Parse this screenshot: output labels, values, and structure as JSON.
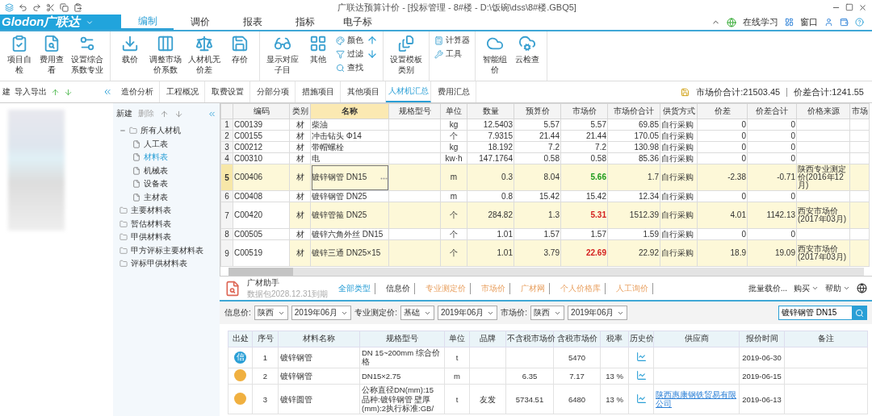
{
  "window": {
    "title": "广联达预算计价 - [投标管理 - 8#楼 - D:\\饭碗\\dss\\8#楼.GBQ5]"
  },
  "menu": {
    "logo": "Glodon广联达",
    "tabs": [
      {
        "label": "编制",
        "selected": true
      },
      {
        "label": "调价",
        "selected": false
      },
      {
        "label": "报表",
        "selected": false
      },
      {
        "label": "指标",
        "selected": false
      },
      {
        "label": "电子标",
        "selected": false
      }
    ],
    "right": [
      "在线学习",
      "窗口"
    ]
  },
  "ribbon": {
    "groups": [
      {
        "items": [
          {
            "label": "项目自检",
            "kind": "large"
          },
          {
            "label": "费用查看",
            "kind": "large"
          },
          {
            "label": "设置综合系数专业",
            "kind": "large"
          }
        ]
      },
      {
        "items": [
          {
            "label": "载价",
            "kind": "large"
          },
          {
            "label": "调整市场价系数",
            "kind": "large"
          },
          {
            "label": "人材机无价差",
            "kind": "large"
          },
          {
            "label": "存价",
            "kind": "large"
          }
        ]
      },
      {
        "items": [
          {
            "label": "显示对应子目",
            "kind": "large"
          },
          {
            "label": "其他",
            "kind": "large"
          },
          {
            "label": "颜色",
            "kind": "small"
          },
          {
            "label": "过滤",
            "kind": "small"
          },
          {
            "label": "查找",
            "kind": "small"
          }
        ]
      },
      {
        "items": [
          {
            "label": "设置模板类别",
            "kind": "large"
          }
        ]
      },
      {
        "items": [
          {
            "label": "计算器",
            "kind": "small"
          },
          {
            "label": "工具",
            "kind": "small"
          }
        ]
      },
      {
        "items": [
          {
            "label": "智能组价",
            "kind": "large"
          },
          {
            "label": "云检查",
            "kind": "large"
          }
        ]
      }
    ]
  },
  "left_toolbar": [
    "建",
    "导入导出"
  ],
  "view_tabs": [
    {
      "label": "造价分析",
      "selected": false
    },
    {
      "label": "工程概况",
      "selected": false
    },
    {
      "label": "取费设置",
      "selected": false
    },
    {
      "label": "分部分项",
      "selected": false
    },
    {
      "label": "措施项目",
      "selected": false
    },
    {
      "label": "其他项目",
      "selected": false
    },
    {
      "label": "人材机汇总",
      "selected": true
    },
    {
      "label": "费用汇总",
      "selected": false
    }
  ],
  "totals": [
    "市场价合计:21503.45",
    "价差合计:1241.55"
  ],
  "tree": {
    "toolbar": [
      {
        "label": "新建",
        "disabled": false
      },
      {
        "label": "删除",
        "disabled": true
      }
    ],
    "items": [
      {
        "label": "所有人材机",
        "expanded": true,
        "selected": false,
        "children": [
          {
            "label": "人工表",
            "selected": false
          },
          {
            "label": "材料表",
            "selected": true
          },
          {
            "label": "机械表",
            "selected": false
          },
          {
            "label": "设备表",
            "selected": false
          },
          {
            "label": "主材表",
            "selected": false
          }
        ]
      },
      {
        "label": "主要材料表",
        "selected": false
      },
      {
        "label": "暂估材料表",
        "selected": false
      },
      {
        "label": "甲供材料表",
        "selected": false
      },
      {
        "label": "甲方评标主要材料表",
        "selected": false
      },
      {
        "label": "评标甲供材料表",
        "selected": false
      }
    ]
  },
  "table": {
    "columns": [
      {
        "label": "编码",
        "selected": false
      },
      {
        "label": "类别",
        "selected": false
      },
      {
        "label": "名称",
        "selected": true
      },
      {
        "label": "规格型号",
        "selected": false
      },
      {
        "label": "单位",
        "selected": false
      },
      {
        "label": "数量",
        "selected": false
      },
      {
        "label": "预算价",
        "selected": false
      },
      {
        "label": "市场价",
        "selected": false
      },
      {
        "label": "市场价合计",
        "selected": false
      },
      {
        "label": "供货方式",
        "selected": false
      },
      {
        "label": "价差",
        "selected": false
      },
      {
        "label": "价差合计",
        "selected": false
      },
      {
        "label": "价格来源",
        "selected": false
      },
      {
        "label": "市场",
        "selected": false
      }
    ],
    "rows": [
      {
        "num": "1",
        "cells": [
          "C00139",
          "材",
          "柴油",
          "",
          "kg",
          "12.5403",
          "5.57",
          "5.57",
          "69.85",
          "自行采购",
          "0",
          "0",
          "",
          ""
        ],
        "highlight": false,
        "selected": false,
        "raised": false,
        "lowered": false
      },
      {
        "num": "2",
        "cells": [
          "C00155",
          "材",
          "冲击钻头 Φ14",
          "",
          "个",
          "7.9315",
          "21.44",
          "21.44",
          "170.05",
          "自行采购",
          "0",
          "0",
          "",
          ""
        ],
        "highlight": false,
        "selected": false,
        "raised": false,
        "lowered": false
      },
      {
        "num": "3",
        "cells": [
          "C00212",
          "材",
          "带帽螺栓",
          "",
          "kg",
          "18.192",
          "7.2",
          "7.2",
          "130.98",
          "自行采购",
          "0",
          "0",
          "",
          ""
        ],
        "highlight": false,
        "selected": false,
        "raised": false,
        "lowered": false
      },
      {
        "num": "4",
        "cells": [
          "C00310",
          "材",
          "电",
          "",
          "kw·h",
          "147.1764",
          "0.58",
          "0.58",
          "85.36",
          "自行采购",
          "0",
          "0",
          "",
          ""
        ],
        "highlight": false,
        "selected": false,
        "raised": false,
        "lowered": false
      },
      {
        "num": "5",
        "cells": [
          "C00406",
          "材",
          "镀锌钢管 DN15",
          "",
          "m",
          "0.3",
          "8.04",
          "5.66",
          "1.7",
          "自行采购",
          "-2.38",
          "-0.71",
          "陕西专业测定价(2016年12月)",
          ""
        ],
        "highlight": true,
        "selected": true,
        "raised": false,
        "lowered": true
      },
      {
        "num": "6",
        "cells": [
          "C00408",
          "材",
          "镀锌钢管 DN25",
          "",
          "m",
          "0.8",
          "15.42",
          "15.42",
          "12.34",
          "自行采购",
          "0",
          "0",
          "",
          ""
        ],
        "highlight": false,
        "selected": false,
        "raised": false,
        "lowered": false
      },
      {
        "num": "7",
        "cells": [
          "C00420",
          "材",
          "镀锌管箍 DN25",
          "",
          "个",
          "284.82",
          "1.3",
          "5.31",
          "1512.39",
          "自行采购",
          "4.01",
          "1142.13",
          "西安市场价(2017年03月)",
          ""
        ],
        "highlight": true,
        "selected": false,
        "raised": true,
        "lowered": false
      },
      {
        "num": "8",
        "cells": [
          "C00505",
          "材",
          "镀锌六角外丝 DN15",
          "",
          "个",
          "1.01",
          "1.57",
          "1.57",
          "1.59",
          "自行采购",
          "0",
          "0",
          "",
          ""
        ],
        "highlight": false,
        "selected": false,
        "raised": false,
        "lowered": false
      },
      {
        "num": "9",
        "cells": [
          "C00519",
          "材",
          "镀锌三通 DN25×15",
          "",
          "个",
          "1.01",
          "3.79",
          "22.69",
          "22.92",
          "自行采购",
          "18.9",
          "19.09",
          "西安市场价(2017年03月)",
          ""
        ],
        "highlight": true,
        "selected": false,
        "raised": true,
        "lowered": false
      }
    ]
  },
  "assistant": {
    "title": "广材助手",
    "subtitle": "数据包2028.12.31到期",
    "tabs": [
      {
        "label": "全部类型",
        "selected": true
      },
      {
        "label": "信息价",
        "selected": false
      },
      {
        "label": "专业测定价",
        "selected": false
      },
      {
        "label": "市场价",
        "selected": false
      },
      {
        "label": "广材网",
        "selected": false
      },
      {
        "label": "个人价格库",
        "selected": false
      },
      {
        "label": "人工询价",
        "selected": false
      }
    ],
    "actions": [
      "批量载价...",
      "购买",
      "帮助"
    ],
    "filters": [
      {
        "label": "信息价:",
        "selects": [
          "陕西",
          "2019年06月"
        ]
      },
      {
        "label": "专业测定价:",
        "selects": [
          "基础",
          "2019年06月"
        ]
      },
      {
        "label": "市场价:",
        "selects": [
          "陕西",
          "2019年06月"
        ]
      }
    ],
    "search": {
      "value": "镀锌钢管 DN15"
    },
    "columns": [
      "出处",
      "序号",
      "材料名称",
      "规格型号",
      "单位",
      "品牌",
      "不含税市场价",
      "含税市场价",
      "税率",
      "历史价",
      "供应商",
      "报价时间",
      "备注"
    ],
    "rows": [
      {
        "kind": "info",
        "mark": "信",
        "seq": "1",
        "name": "镀锌钢管",
        "spec": "DN 15~200mm  综合价格",
        "unit": "t",
        "brand": "",
        "price_ex": "",
        "price_in": "5470",
        "tax": "",
        "supplier": "",
        "date": "2019-06-30"
      },
      {
        "kind": "market",
        "mark": "",
        "seq": "2",
        "name": "镀锌钢管",
        "spec": "DN15×2.75",
        "unit": "m",
        "brand": "",
        "price_ex": "6.35",
        "price_in": "7.17",
        "tax": "13 %",
        "supplier": "",
        "date": "2019-06-15"
      },
      {
        "kind": "market",
        "mark": "",
        "seq": "3",
        "name": "镀锌圆管",
        "spec": "公称直径DN(mm):15 品种:镀锌钢管 壁厚(mm):2执行标准:GB/",
        "unit": "t",
        "brand": "友发",
        "price_ex": "5734.51",
        "price_in": "6480",
        "tax": "13 %",
        "supplier": "陕西惠康钢铁贸易有限公司",
        "date": "2019-06-13"
      }
    ]
  }
}
